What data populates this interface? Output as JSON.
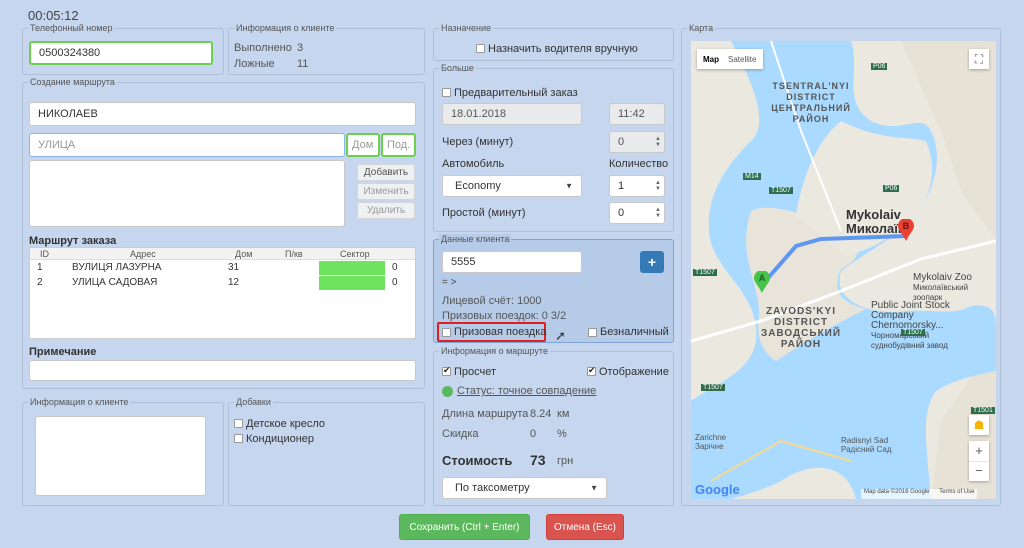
{
  "timer": "00:05:12",
  "phone": {
    "legend": "Телефонный номер",
    "value": "0500324380"
  },
  "client_info_top": {
    "legend": "Информация о клиенте",
    "rows": [
      {
        "label": "Выполнено",
        "value": "3"
      },
      {
        "label": "Ложные",
        "value": "11"
      }
    ]
  },
  "route_create": {
    "legend": "Создание маршрута",
    "city": "НИКОЛАЕВ",
    "street_placeholder": "УЛИЦА",
    "house_placeholder": "Дом",
    "entrance_placeholder": "Под.",
    "add": "Добавить",
    "change": "Изменить",
    "delete": "Удалить"
  },
  "order_route": {
    "title": "Маршрут заказа",
    "headers": [
      "ID",
      "Адрес",
      "Дом",
      "П/кв",
      "Сектор"
    ],
    "rows": [
      {
        "id": "1",
        "address": "ВУЛИЦЯ ЛАЗУРНА",
        "house": "31",
        "apt": "",
        "sector": "0"
      },
      {
        "id": "2",
        "address": "УЛИЦА САДОВАЯ",
        "house": "12",
        "apt": "",
        "sector": "0"
      }
    ]
  },
  "note": {
    "title": "Примечание"
  },
  "client_info_bottom": {
    "legend": "Информация о клиенте"
  },
  "extras": {
    "legend": "Добавки",
    "items": [
      "Детское кресло",
      "Кондиционер"
    ]
  },
  "assign": {
    "legend": "Назначение",
    "label": "Назначить водителя вручную"
  },
  "more": {
    "legend": "Больше",
    "preorder": "Предварительный заказ",
    "date": "18.01.2018",
    "time": "11:42",
    "in_label": "Через (минут)",
    "in_value": "0",
    "car_label": "Автомобиль",
    "car_value": "Economy",
    "qty_label": "Количество",
    "qty_value": "1",
    "idle_label": "Простой (минут)",
    "idle_value": "0"
  },
  "client_data": {
    "legend": "Данные клиента",
    "input": "5555",
    "plus": "+",
    "arrow": "= >",
    "account": "Лицевой счёт: 1000",
    "prize_trips": "Призовых поездок: 0 3/2",
    "prize_trip": "Призовая поездка",
    "cashless": "Безналичный"
  },
  "route_info": {
    "legend": "Информация о маршруте",
    "recalc": "Просчет",
    "display": "Отображение",
    "status": "Статус: точное совпадение",
    "length_label": "Длина маршрута",
    "length_value": "8.24",
    "length_unit": "км",
    "discount_label": "Скидка",
    "discount_value": "0",
    "discount_unit": "%",
    "cost_label": "Стоимость",
    "cost_value": "73",
    "cost_unit": "грн",
    "tariff": "По таксометру"
  },
  "map": {
    "legend": "Карта",
    "tab_map": "Map",
    "tab_satellite": "Satellite",
    "labels": {
      "d1a": "TSENTRAL'NYI",
      "d1b": "DISTRICT",
      "d1c": "ЦЕНТРАЛЬНИЙ",
      "d1d": "РАЙОН",
      "city1": "Mykolaiv",
      "city2": "Миколаїв",
      "zoo1": "Mykolaiv Zoo",
      "zoo2": "Миколаївський зоопарк",
      "ps1": "Public Joint Stock",
      "ps2": "Company",
      "ps3": "Chernomorsky...",
      "ps4": "Чорноморський",
      "ps5": "суднобудівний завод",
      "d2a": "ZAVODS'KYI",
      "d2b": "DISTRICT",
      "d2c": "ЗАВОДСЬКИЙ",
      "d2d": "РАЙОН",
      "zarichne1": "Zarichne",
      "zarichne2": "Зарічне",
      "rs1": "Radisnyi Sad",
      "rs2": "Радісний Сад",
      "r_m14": "M14",
      "r_t1507a": "T1507",
      "r_t1507b": "T1507",
      "r_t1507c": "T1507",
      "r_t1507d": "T1507",
      "r_t1501": "T1501",
      "r_p06a": "P06",
      "r_p06b": "P06",
      "marker_a": "A",
      "marker_b": "B",
      "google": "Google",
      "mapdata": "Map data ©2018 Google",
      "terms": "Terms of Use",
      "zoom_in": "+",
      "zoom_out": "−"
    }
  },
  "buttons": {
    "save": "Сохранить (Ctrl + Enter)",
    "cancel": "Отмена (Esc)"
  },
  "colors": {
    "bg": "#c5d6ee",
    "green": "#5cb85c",
    "red": "#d9534f",
    "blue": "#337ab7",
    "sector": "#6de35e",
    "water": "#aadaff",
    "route": "#4f8ef2"
  }
}
